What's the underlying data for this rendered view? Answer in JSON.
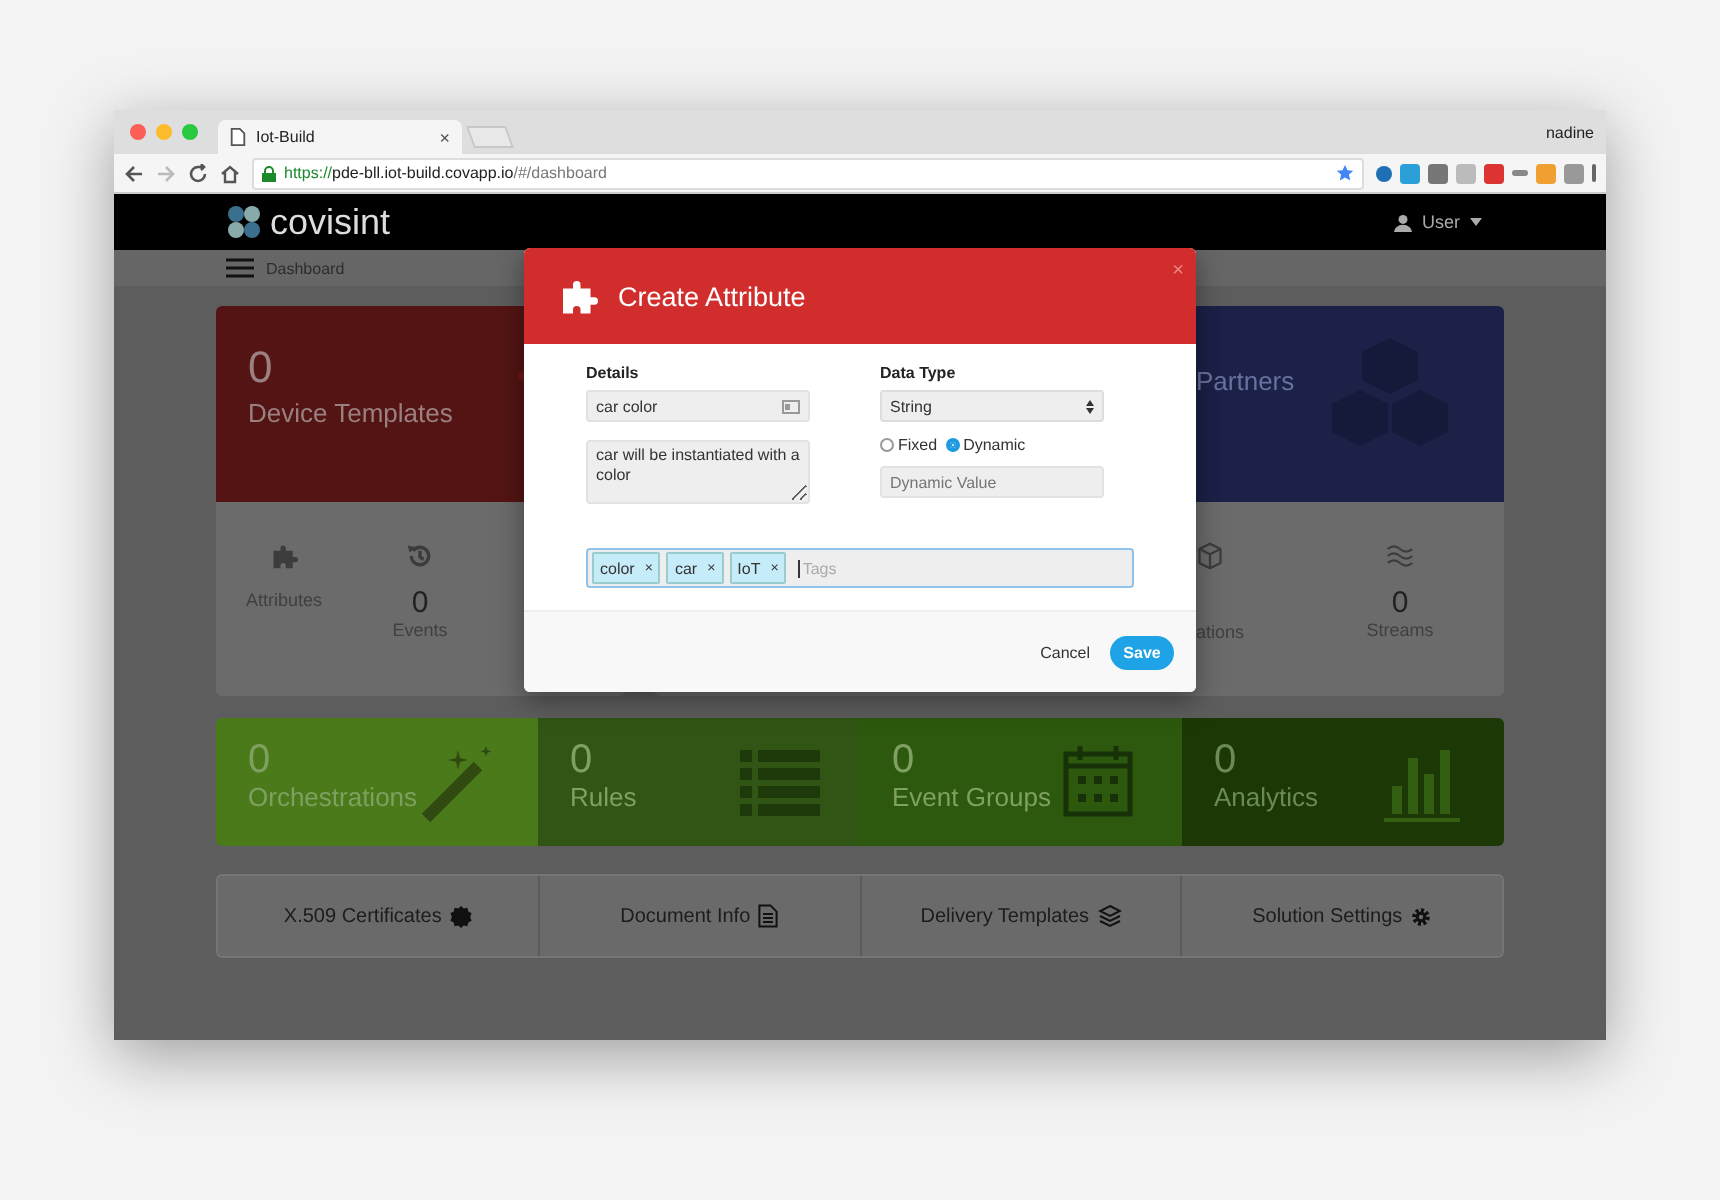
{
  "browser": {
    "tab_title": "Iot-Build",
    "tab_close": "×",
    "profile": "nadine",
    "url": {
      "scheme": "https://",
      "host": "pde-bll.iot-build.covapp.io",
      "path": "/#/dashboard"
    }
  },
  "app": {
    "brand": "covisint",
    "user": "User",
    "breadcrumb": "Dashboard"
  },
  "cards": [
    {
      "color": "#541414",
      "count": "0",
      "title": "Device Templates",
      "stats": [
        {
          "label": "Attributes"
        },
        {
          "count": "0",
          "label": "Events"
        }
      ]
    },
    {
      "color": "#1b2147",
      "title": "Partners",
      "stats": [
        {
          "label": "ations"
        },
        {
          "count": "0",
          "label": "Streams"
        }
      ]
    }
  ],
  "tiles": [
    {
      "count": "0",
      "label": "Orchestrations",
      "color": "#4b7a1b"
    },
    {
      "count": "0",
      "label": "Rules",
      "color": "#305514"
    },
    {
      "count": "0",
      "label": "Event Groups",
      "color": "#2c590e"
    },
    {
      "count": "0",
      "label": "Analytics",
      "color": "#1c3806"
    }
  ],
  "links": [
    "X.509 Certificates",
    "Document Info",
    "Delivery Templates",
    "Solution Settings"
  ],
  "modal": {
    "title": "Create Attribute",
    "close": "×",
    "details_label": "Details",
    "name_value": "car color",
    "description_value": "car will be instantiated with a color",
    "data_type_label": "Data Type",
    "data_type_value": "String",
    "value_modes": [
      {
        "label": "Fixed",
        "selected": false
      },
      {
        "label": "Dynamic",
        "selected": true
      }
    ],
    "value_placeholder": "Dynamic Value",
    "tags": [
      {
        "label": "color",
        "remove": "×"
      },
      {
        "label": "car",
        "remove": "×"
      },
      {
        "label": "IoT",
        "remove": "×"
      }
    ],
    "tags_placeholder": "Tags",
    "cancel": "Cancel",
    "save": "Save"
  }
}
